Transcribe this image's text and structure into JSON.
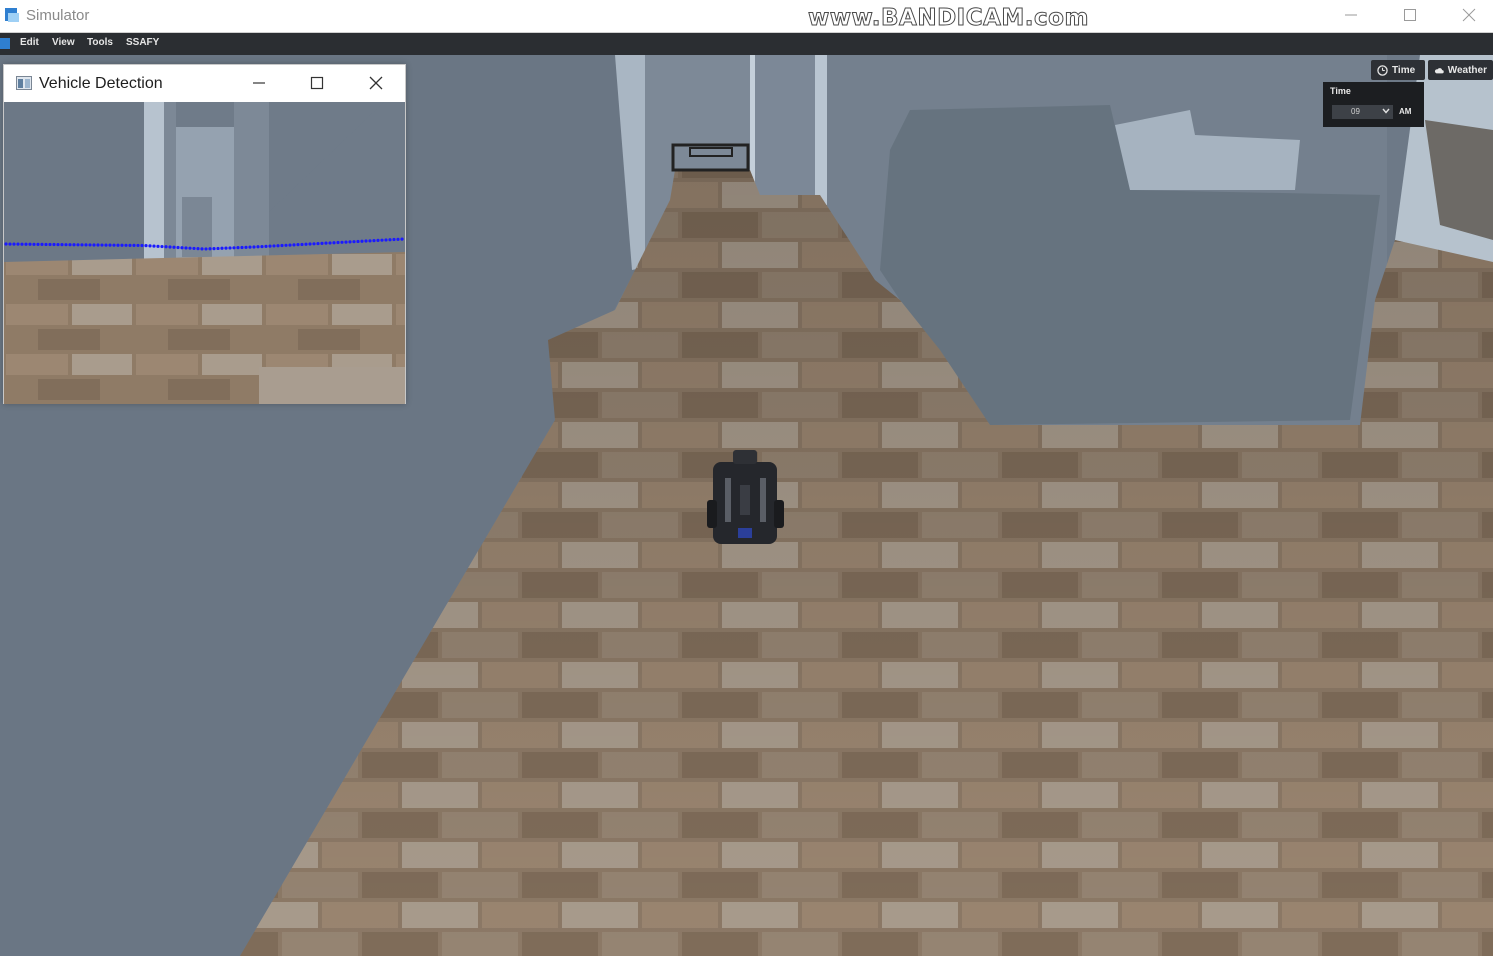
{
  "window": {
    "title": "Simulator",
    "watermark": "www.BANDICAM.com"
  },
  "menu": {
    "items": [
      "Edit",
      "View",
      "Tools",
      "SSAFY"
    ]
  },
  "toolbar": {
    "time_label": "Time",
    "weather_label": "Weather"
  },
  "time_panel": {
    "label": "Time",
    "hour": "09",
    "period": "AM"
  },
  "vehicle_detection": {
    "title": "Vehicle Detection"
  },
  "icons": {
    "app": "simulator-icon",
    "clock": "clock-icon",
    "weather": "cloud-icon",
    "minimize": "minimize-icon",
    "maximize": "maximize-icon",
    "close": "close-icon"
  },
  "colors": {
    "menubar": "#2b2e32",
    "toolbar": "#2d3035",
    "detection_dots": "#1a1aff",
    "wall": "#6b7785",
    "floor": "#8d7a66"
  }
}
